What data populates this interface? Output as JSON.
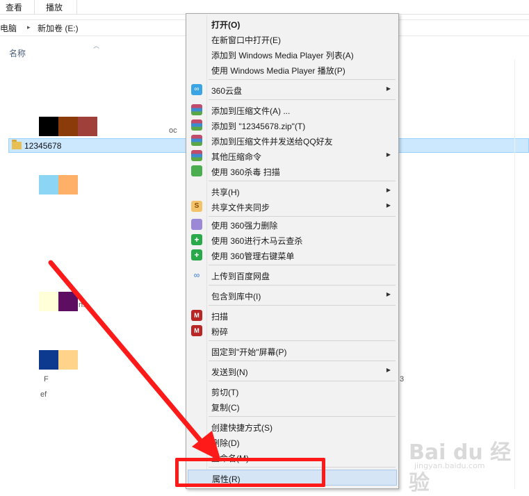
{
  "ribbon": {
    "tabs": [
      "查看",
      "播放"
    ]
  },
  "address": {
    "parts": [
      "电脑",
      "新加卷 (E:)"
    ]
  },
  "columns": {
    "name": "名称"
  },
  "files": [
    {
      "name": "12345678",
      "selected": true
    }
  ],
  "fragments": [
    "oc",
    "n.",
    "F",
    "3",
    "ef"
  ],
  "context_menu": {
    "items": [
      {
        "label": "打开(O)",
        "bold": true,
        "icon": null,
        "submenu": false
      },
      {
        "label": "在新窗口中打开(E)",
        "icon": null,
        "submenu": false
      },
      {
        "label": "添加到 Windows Media Player 列表(A)",
        "icon": null,
        "submenu": false
      },
      {
        "label": "使用 Windows Media Player 播放(P)",
        "icon": null,
        "submenu": false
      },
      {
        "label": "360云盘",
        "icon": "cloud-icon",
        "submenu": true
      },
      {
        "label": "添加到压缩文件(A) ...",
        "icon": "archive-icon",
        "submenu": false
      },
      {
        "label": "添加到 \"12345678.zip\"(T)",
        "icon": "archive-icon",
        "submenu": false
      },
      {
        "label": "添加到压缩文件并发送给QQ好友",
        "icon": "archive-icon",
        "submenu": false
      },
      {
        "label": "其他压缩命令",
        "icon": "archive-icon",
        "submenu": true
      },
      {
        "label": "使用 360杀毒 扫描",
        "icon": "shield-icon",
        "submenu": false
      },
      {
        "label": "共享(H)",
        "icon": null,
        "submenu": true
      },
      {
        "label": "共享文件夹同步",
        "icon": "sync-icon",
        "submenu": true
      },
      {
        "label": "使用 360强力删除",
        "icon": "shredder-icon",
        "submenu": false
      },
      {
        "label": "使用 360进行木马云查杀",
        "icon": "360-icon",
        "submenu": false
      },
      {
        "label": "使用 360管理右键菜单",
        "icon": "360-icon",
        "submenu": false
      },
      {
        "label": "上传到百度网盘",
        "icon": "baidu-cloud-icon",
        "submenu": false
      },
      {
        "label": "包含到库中(I)",
        "icon": null,
        "submenu": true
      },
      {
        "label": "扫描",
        "icon": "mcafee-icon",
        "submenu": false
      },
      {
        "label": "粉碎",
        "icon": "mcafee-icon",
        "submenu": false
      },
      {
        "label": "固定到\"开始\"屏幕(P)",
        "icon": null,
        "submenu": false
      },
      {
        "label": "发送到(N)",
        "icon": null,
        "submenu": true
      },
      {
        "label": "剪切(T)",
        "icon": null,
        "submenu": false
      },
      {
        "label": "复制(C)",
        "icon": null,
        "submenu": false
      },
      {
        "label": "创建快捷方式(S)",
        "icon": null,
        "submenu": false
      },
      {
        "label": "删除(D)",
        "icon": null,
        "submenu": false
      },
      {
        "label": "重命名(M)",
        "icon": null,
        "submenu": false
      },
      {
        "label": "属性(R)",
        "icon": null,
        "submenu": false,
        "highlighted": true
      }
    ]
  },
  "watermark": {
    "brand": "Bai du 经验",
    "url": "jingyan.baidu.com"
  },
  "colors": {
    "highlight": "#ff1a1a",
    "selection": "#cce8ff",
    "menu_bg": "#f2f2f2"
  }
}
